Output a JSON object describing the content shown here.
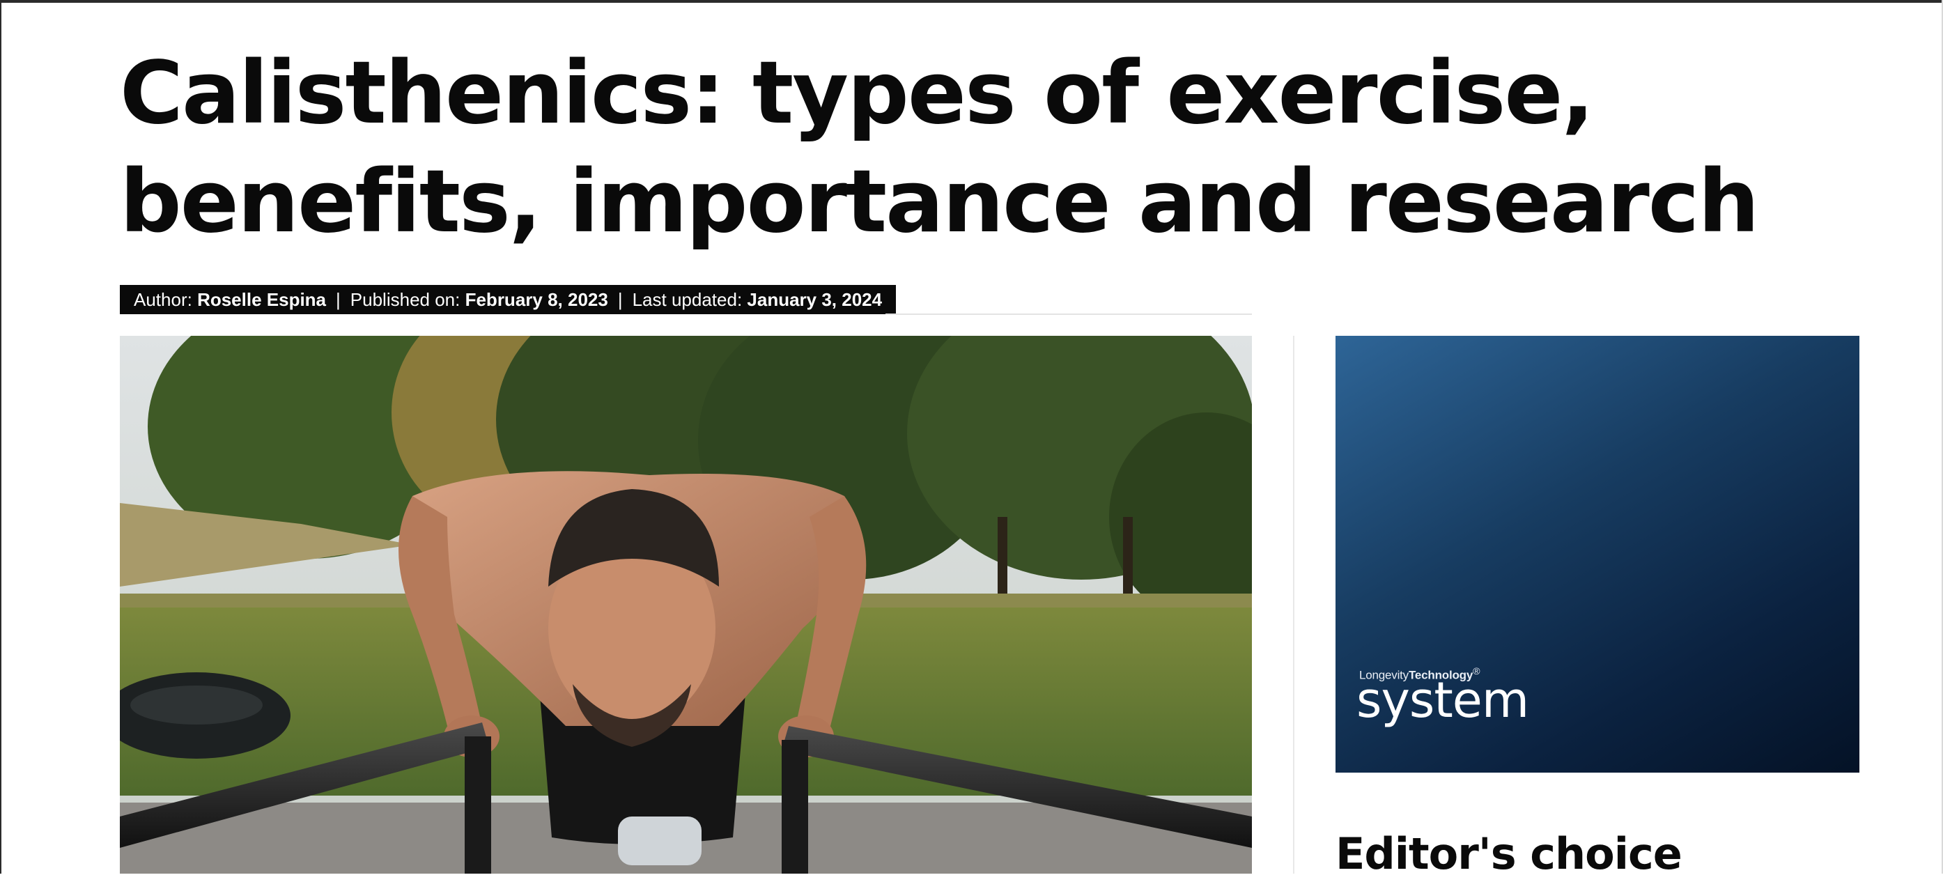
{
  "article": {
    "title": "Calisthenics: types of exercise, benefits, importance and research",
    "meta": {
      "author_label": "Author:",
      "author_name": "Roselle Espina",
      "published_label": "Published on:",
      "published_date": "February 8, 2023",
      "updated_label": "Last updated:",
      "updated_date": "January 3, 2024",
      "separator": "|"
    },
    "hero_image": {
      "icon": "hero-photo",
      "subject": "man doing parallel bar dips in a park"
    }
  },
  "sidebar": {
    "ad": {
      "kicker_regular": "Longevity",
      "kicker_bold": "Technology",
      "kicker_mark": "®",
      "brand": "system"
    },
    "section_title": "Editor's choice"
  },
  "colors": {
    "text": "#0a0a0a",
    "meta_bar_bg": "#0a0a0a",
    "ad_gradient_start": "#2e6597",
    "ad_gradient_end": "#041226"
  }
}
